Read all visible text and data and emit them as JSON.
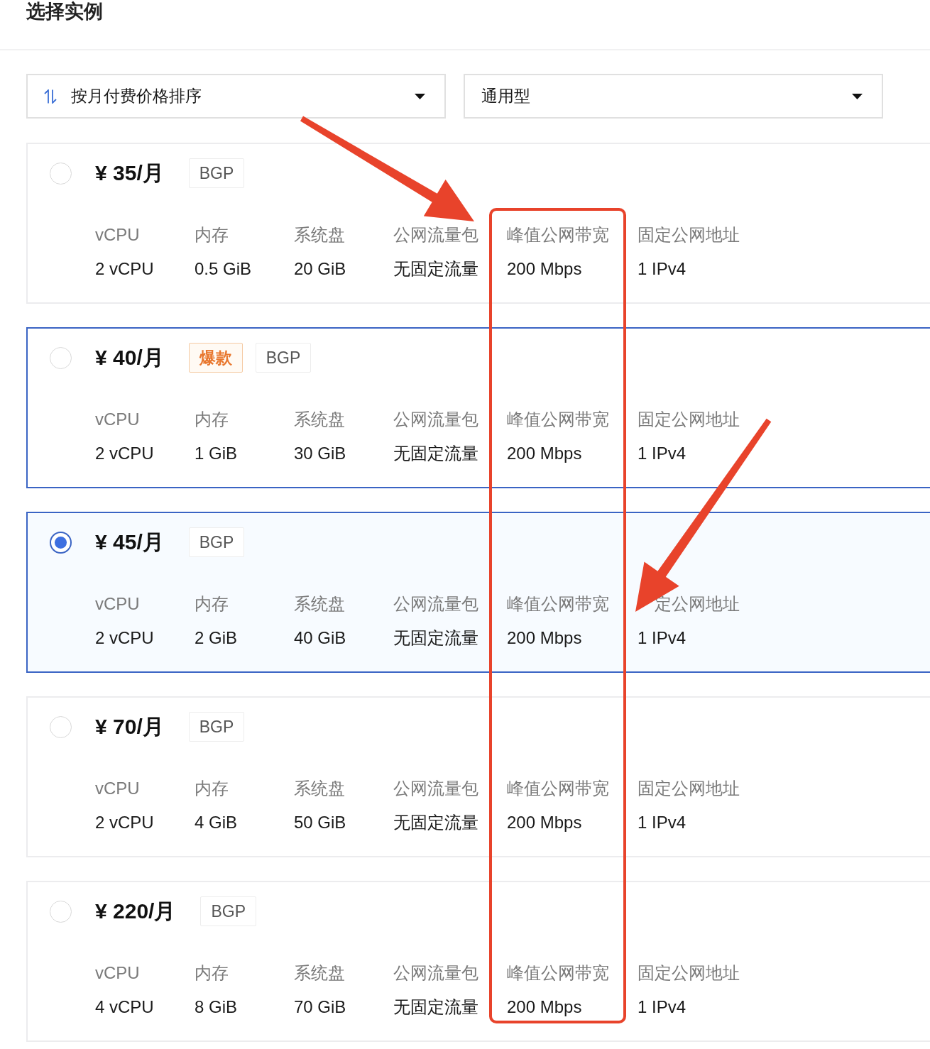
{
  "section": {
    "title": "选择实例"
  },
  "filters": [
    {
      "kind": "sort",
      "label": "按月付费价格排序"
    },
    {
      "kind": "plain",
      "label": "通用型"
    }
  ],
  "instances": [
    {
      "price": "¥ 35/月",
      "selected": false,
      "highlighted": false,
      "tags": [
        {
          "kind": "network",
          "label": "BGP"
        }
      ],
      "specs": [
        {
          "label": "vCPU",
          "value": "2 vCPU"
        },
        {
          "label": "内存",
          "value": "0.5 GiB"
        },
        {
          "label": "系统盘",
          "value": "20 GiB"
        },
        {
          "label": "公网流量包",
          "value": "无固定流量"
        },
        {
          "label": "峰值公网带宽",
          "value": "200 Mbps"
        },
        {
          "label": "固定公网地址",
          "value": "1 IPv4"
        }
      ]
    },
    {
      "price": "¥ 40/月",
      "selected": false,
      "highlighted": true,
      "tags": [
        {
          "kind": "hot",
          "label": "爆款"
        },
        {
          "kind": "network",
          "label": "BGP"
        }
      ],
      "specs": [
        {
          "label": "vCPU",
          "value": "2 vCPU"
        },
        {
          "label": "内存",
          "value": "1 GiB"
        },
        {
          "label": "系统盘",
          "value": "30 GiB"
        },
        {
          "label": "公网流量包",
          "value": "无固定流量"
        },
        {
          "label": "峰值公网带宽",
          "value": "200 Mbps"
        },
        {
          "label": "固定公网地址",
          "value": "1 IPv4"
        }
      ]
    },
    {
      "price": "¥ 45/月",
      "selected": true,
      "highlighted": true,
      "tags": [
        {
          "kind": "network",
          "label": "BGP"
        }
      ],
      "specs": [
        {
          "label": "vCPU",
          "value": "2 vCPU"
        },
        {
          "label": "内存",
          "value": "2 GiB"
        },
        {
          "label": "系统盘",
          "value": "40 GiB"
        },
        {
          "label": "公网流量包",
          "value": "无固定流量"
        },
        {
          "label": "峰值公网带宽",
          "value": "200 Mbps"
        },
        {
          "label": "定公网地址",
          "value": "1 IPv4"
        }
      ]
    },
    {
      "price": "¥ 70/月",
      "selected": false,
      "highlighted": false,
      "tags": [
        {
          "kind": "network",
          "label": "BGP"
        }
      ],
      "specs": [
        {
          "label": "vCPU",
          "value": "2 vCPU"
        },
        {
          "label": "内存",
          "value": "4 GiB"
        },
        {
          "label": "系统盘",
          "value": "50 GiB"
        },
        {
          "label": "公网流量包",
          "value": "无固定流量"
        },
        {
          "label": "峰值公网带宽",
          "value": "200 Mbps"
        },
        {
          "label": "固定公网地址",
          "value": "1 IPv4"
        }
      ]
    },
    {
      "price": "¥ 220/月",
      "selected": false,
      "highlighted": false,
      "tags": [
        {
          "kind": "network",
          "label": "BGP"
        }
      ],
      "specs": [
        {
          "label": "vCPU",
          "value": "4 vCPU"
        },
        {
          "label": "内存",
          "value": "8 GiB"
        },
        {
          "label": "系统盘",
          "value": "70 GiB"
        },
        {
          "label": "公网流量包",
          "value": "无固定流量"
        },
        {
          "label": "峰值公网带宽",
          "value": "200 Mbps"
        },
        {
          "label": "固定公网地址",
          "value": "1 IPv4"
        }
      ]
    }
  ],
  "annotations": [
    {
      "kind": "arrow"
    },
    {
      "kind": "frame"
    },
    {
      "kind": "arrow"
    }
  ]
}
